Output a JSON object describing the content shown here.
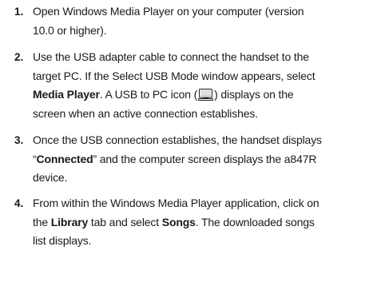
{
  "steps": [
    {
      "number": "1.",
      "line1": "Open Windows Media Player on your computer (version",
      "line2": "10.0 or higher)."
    },
    {
      "number": "2.",
      "line1": "Use the USB adapter cable to connect the handset to the",
      "line2_a": "target PC. If the Select USB Mode window appears, select",
      "line3_bold": "Media Player",
      "line3_rest": ". A USB to PC icon (",
      "line3_end": ") displays on the",
      "line4": "screen when an active connection establishes.",
      "icon": "usb-to-pc-icon"
    },
    {
      "number": "3.",
      "line1": "Once the USB connection establishes, the handset displays",
      "line2_open_quote": "“",
      "line2_bold": "Connected",
      "line2_rest": "” and the computer screen displays the a847R",
      "line3": "device."
    },
    {
      "number": "4.",
      "line1": "From within the Windows Media Player application, click on",
      "line2_a": "the ",
      "line2_bold1": "Library",
      "line2_b": " tab and select ",
      "line2_bold2": "Songs",
      "line2_c": ". The downloaded songs",
      "line3": "list displays."
    }
  ]
}
